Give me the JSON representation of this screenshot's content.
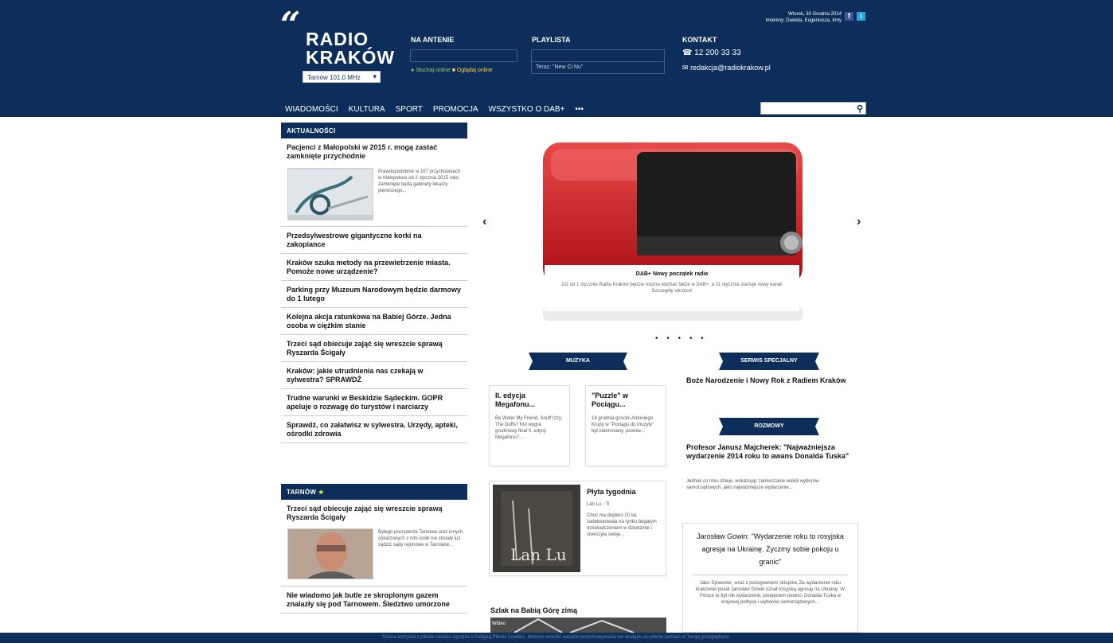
{
  "header": {
    "logo_line1": "RADIO",
    "logo_line2": "KRAKÓW",
    "frequency": "Tarnów 101,0 MHz",
    "date_line1": "Wtorek, 30 Grudnia 2014",
    "date_line2": "Imieniny: Dawida, Eugeniusza, Irmy",
    "na_antenie": "NA ANTENIE",
    "listen_online": "Słuchaj online",
    "watch_online": "Oglądaj online",
    "playlista": "PLAYLISTA",
    "playlist_now": "Teraz: \"New Ci Nu\"",
    "kontakt": "KONTAKT",
    "phone": "12 200 33 33",
    "email": "redakcja@radiokrakow.pl"
  },
  "nav": [
    "WIADOMOŚCI",
    "KULTURA",
    "SPORT",
    "PROMOCJA",
    "WSZYSTKO O DAB+",
    "•••"
  ],
  "aktualnosci": {
    "title": "AKTUALNOŚCI",
    "featured_title": "Pacjenci z Małopolski w 2015 r. mogą zastać zamknięte przychodnie",
    "featured_desc": "Prawdopodobnie w 107 przychodniach w Małopolsce od 2 stycznia 2015 roku zamknięte będą gabinety lekarzy pierwszego...",
    "items": [
      "Przedsylwestrowe gigantyczne korki na zakopiance",
      "Kraków szuka metody na przewietrzenie miasta. Pomoże nowe urządzenie?",
      "Parking przy Muzeum Narodowym będzie darmowy do 1 lutego",
      "Kolejna akcja ratunkowa na Babiej Górze. Jedna osoba w ciężkim stanie",
      "Trzeci sąd obiecuje zająć się wreszcie sprawą Ryszarda Ścigały",
      "Kraków: jakie utrudnienia nas czekają w sylwestra? SPRAWDŹ",
      "Trudne warunki w Beskidzie Sądeckim. GOPR apeluje o rozwagę do turystów i narciarzy",
      "Sprawdź, co załatwisz w sylwestra. Urzędy, apteki, ośrodki zdrowia"
    ]
  },
  "tarnow": {
    "title": "TARNÓW",
    "featured_title": "Trzeci sąd obiecuje zająć się wreszcie sprawą Ryszarda Ścigały",
    "featured_desc": "Byłego prezydenta Tarnowa oraz innych oskarżonych z nim osób nie chciały już sądzić sądy rejonowe w Tarnowie...",
    "items": [
      "Nie wiadomo jak butle ze skroplonym gazem znalazły się pod Tarnowem. Śledztwo umorzone"
    ]
  },
  "slider": {
    "title": "DAB+ Nowy początek radia",
    "desc": "Już od 1 stycznia Radia Kraków będzie można słuchać także w DAB+, a 31 stycznia startuje nowy kanał. Szczegóły wkrótce!",
    "prev": "‹",
    "next": "›",
    "dots": "• • • • •"
  },
  "muzyka": {
    "title": "MUZYKA",
    "cards": [
      {
        "title": "II. edycja Megafonu...",
        "desc": "Be Water My Friend, Snuff Izzy, The Duffs? Kto wygra grudniowy finał II. edycji Megafonu?..."
      },
      {
        "title": "\"Puzzle\" w Pociągu...",
        "desc": "18 grudnia gościni Antoniego Krupy w \"Pociągu do muzyki\" był zatemniany, pewnie..."
      }
    ],
    "album_title": "Płyta tygodnia",
    "album_artist": "Lan Lu - Ti",
    "album_desc": "Choć ma dopiero 20 lat, zadebiutowała na rynku bogatym doświadczeniem w dziedzinie i stworzyła swoje..."
  },
  "serwis": {
    "title": "SERWIS SPECJALNY",
    "item": "Boże Narodzenie i Nowy Rok z Radiem Kraków"
  },
  "rozmowy": {
    "title": "ROZMOWY",
    "headline": "Profesor Janusz Majcherek: \"Najważniejsza wydarzenie 2014 roku to awans Donalda Tuska\"",
    "desc": "Jednak co roku dzieje, wskazując zamieszanie wokół wyborów samorządowych, jako najważniejsze wydarzenie..."
  },
  "quote": {
    "text": "Jarosław Gowin: \"Wydarzenie roku to rosyjska agresja na Ukrainę. Życzmy sobie pokoju u granic\"",
    "desc": "Jako Sylwester, wraz z pożegnaniem sklepów, Za wydarzenie roku krakowski poseł Jarosław Gowin uznał rosyjską agresję na Ukrainę. W Polsce to był rok wydarzenie, przejęciem pewno, Donalda Tuska w krajowej polityce i wyborów samorządowych..."
  },
  "babia": {
    "title": "Szlak na Babią Górę zimą",
    "tag": "Wideo"
  },
  "footer": "Strona korzysta z plików cookies zgodnie z Polityką Plików Cookies. Możesz określić warunki przechowywania lub dostępu do plików cookies w Twojej przeglądarce."
}
